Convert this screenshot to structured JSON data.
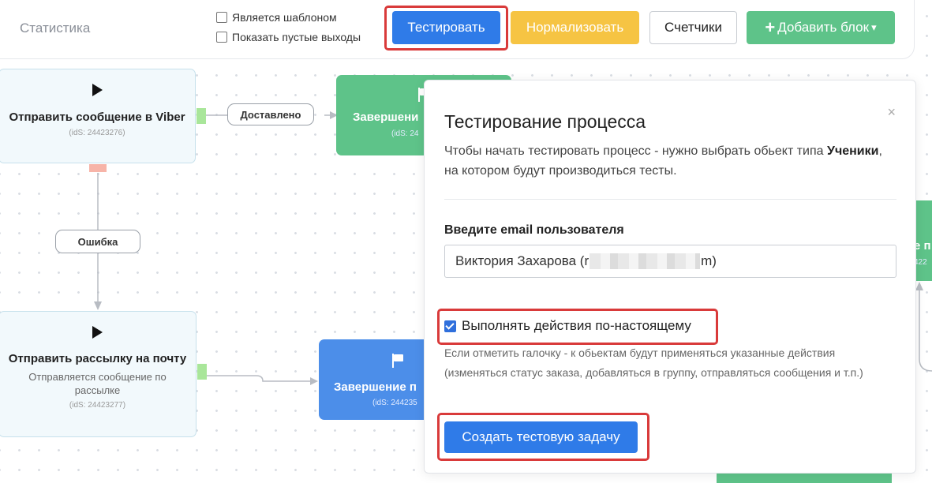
{
  "toolbar": {
    "statistics_label": "Статистика",
    "is_template_label": "Является шаблоном",
    "show_empty_outputs_label": "Показать пустые выходы",
    "test_button": "Тестировать",
    "normalize_button": "Нормализовать",
    "counters_button": "Счетчики",
    "add_block_button": "Добавить блок",
    "add_block_plus": "+",
    "add_block_caret": "▾"
  },
  "canvas": {
    "node_viber": {
      "title": "Отправить сообщение в Viber",
      "ids": "(idS: 24423276)"
    },
    "node_finish_top": {
      "title": "Завершени",
      "ids": "(idS: 24"
    },
    "node_mail": {
      "title": "Отправить рассылку на почту",
      "subtitle": "Отправляется сообщение по рассылке",
      "ids": "(idS: 24423277)"
    },
    "node_finish_bottom": {
      "title": "Завершение п",
      "ids": "(idS: 244235"
    },
    "node_right_partial": {
      "title": "е п",
      "ids": "422"
    },
    "edge_delivered": "Доставлено",
    "edge_error": "Ошибка"
  },
  "modal": {
    "close_glyph": "×",
    "title": "Тестирование процесса",
    "desc_part1": "Чтобы начать тестировать процесс - нужно выбрать обьект типа ",
    "desc_bold": "Ученики",
    "desc_part2": ", на котором будут производиться тесты.",
    "email_label": "Введите email пользователя",
    "email_value_prefix": "Виктория Захарова (r",
    "email_value_suffix": "m)",
    "real_actions_label": "Выполнять действия по-настоящему",
    "real_actions_checked": true,
    "hint": "Если отметить галочку - к обьектам будут применяться указанные действия (изменяться статус заказа, добавляться в группу, отправляться сообщения и т.п.)",
    "create_button": "Создать тестовую задачу"
  },
  "colors": {
    "primary": "#2f7be8",
    "warning": "#f6c443",
    "success": "#5ec389",
    "highlight": "#d93a3a",
    "node_blue": "#4c8ee9"
  }
}
